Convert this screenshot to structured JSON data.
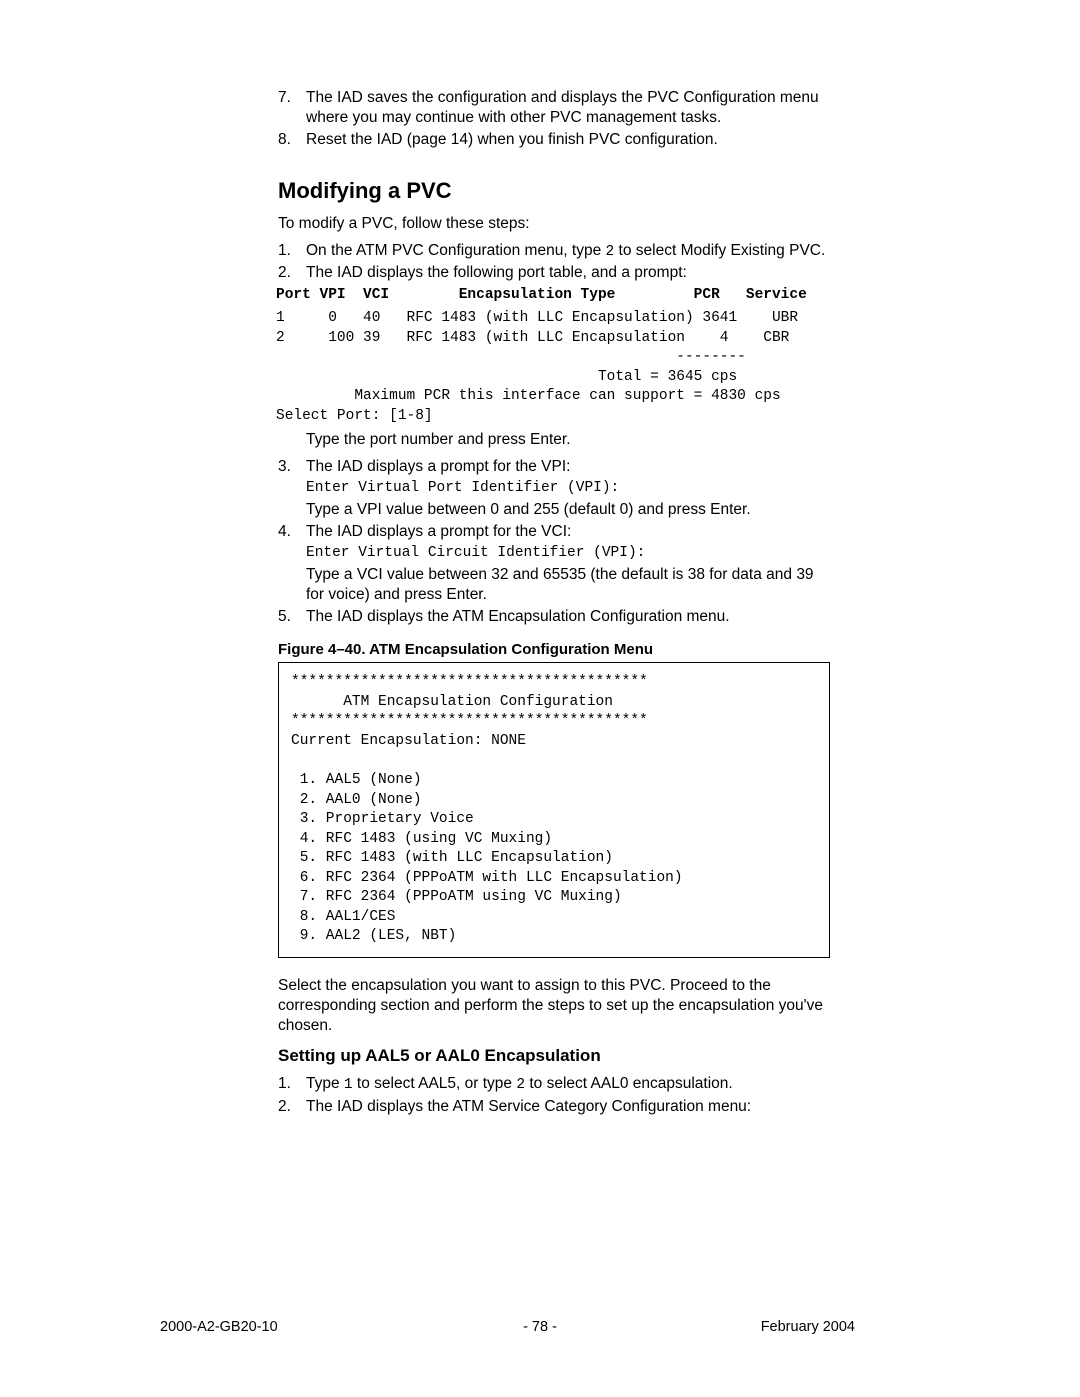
{
  "intro_items": [
    {
      "num": "7.",
      "text": "The IAD saves the configuration and displays the PVC Configuration menu where you may continue with other PVC management tasks."
    },
    {
      "num": "8.",
      "text": "Reset the IAD (page 14) when you finish PVC configuration."
    }
  ],
  "section_heading": "Modifying a PVC",
  "section_lead": "To modify a PVC, follow these steps:",
  "step1": {
    "num": "1.",
    "pre": "On the ATM PVC Configuration menu, type ",
    "code": "2",
    "post": " to select Modify Existing PVC."
  },
  "step2": {
    "num": "2.",
    "text": "The IAD displays the following port table, and a prompt:"
  },
  "port_table_header": "Port VPI  VCI        Encapsulation Type         PCR   Service",
  "port_table_body": "1     0   40   RFC 1483 (with LLC Encapsulation) 3641    UBR\n2     100 39   RFC 1483 (with LLC Encapsulation    4    CBR\n                                              --------\n                                     Total = 3645 cps\n         Maximum PCR this interface can support = 4830 cps\nSelect Port: [1-8]",
  "step2_tail": "Type the port number and press Enter.",
  "step3": {
    "num": "3.",
    "text": "The IAD displays a prompt for the VPI:",
    "code": "Enter Virtual Port Identifier (VPI):",
    "tail": "Type a VPI value between 0 and 255 (default 0) and press Enter."
  },
  "step4": {
    "num": "4.",
    "text": "The IAD displays a prompt for the VCI:",
    "code": "Enter Virtual Circuit Identifier (VPI):",
    "tail": "Type a VCI value between 32 and 65535 (the default is 38 for data and 39 for voice) and press Enter."
  },
  "step5": {
    "num": "5.",
    "text": "The IAD displays the ATM Encapsulation Configuration menu."
  },
  "figure_caption": "Figure 4–40.  ATM Encapsulation Configuration Menu",
  "figure_body": "*****************************************\n      ATM Encapsulation Configuration\n*****************************************\nCurrent Encapsulation: NONE\n\n 1. AAL5 (None)\n 2. AAL0 (None)\n 3. Proprietary Voice\n 4. RFC 1483 (using VC Muxing)\n 5. RFC 1483 (with LLC Encapsulation)\n 6. RFC 2364 (PPPoATM with LLC Encapsulation)\n 7. RFC 2364 (PPPoATM using VC Muxing)\n 8. AAL1/CES\n 9. AAL2 (LES, NBT)",
  "after_figure": "Select the encapsulation you want to assign to this PVC. Proceed to the corresponding section and perform the steps to set up the encapsulation you've chosen.",
  "sub_heading": "Setting up AAL5 or AAL0 Encapsulation",
  "sub_step1": {
    "num": "1.",
    "pre": "Type ",
    "code1": "1",
    "mid": " to select AAL5, or type ",
    "code2": "2",
    "post": " to select AAL0 encapsulation."
  },
  "sub_step2": {
    "num": "2.",
    "text": "The IAD displays the ATM Service Category Configuration menu:"
  },
  "footer": {
    "left": "2000-A2-GB20-10",
    "mid": "- 78 -",
    "right": "February 2004"
  }
}
